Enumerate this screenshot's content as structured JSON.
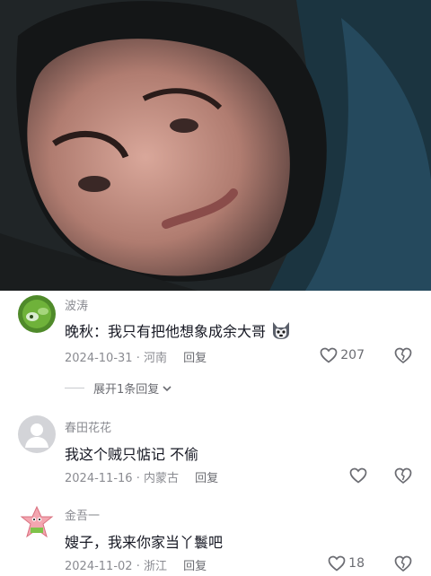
{
  "comments": [
    {
      "username": "波涛",
      "text": "晚秋：我只有把他想象成余大哥",
      "date": "2024-10-31",
      "location": "河南",
      "reply_label": "回复",
      "likes": "207",
      "expand_label": "展开1条回复"
    },
    {
      "username": "春田花花",
      "text": "我这个贼只惦记 不偷",
      "date": "2024-11-16",
      "location": "内蒙古",
      "reply_label": "回复",
      "likes": ""
    },
    {
      "username": "金吾一",
      "text": "嫂子，我来你家当丫鬟吧",
      "date": "2024-11-02",
      "location": "浙江",
      "reply_label": "回复",
      "likes": "18"
    }
  ],
  "separator": "·",
  "icons": {
    "like": "heart-outline-icon",
    "dislike": "broken-heart-icon",
    "expand": "chevron-down-icon",
    "emoji": "husky-dog-emoji-icon"
  },
  "colors": {
    "text_primary": "#161823",
    "text_secondary": "#8a8b91",
    "background": "#ffffff"
  }
}
